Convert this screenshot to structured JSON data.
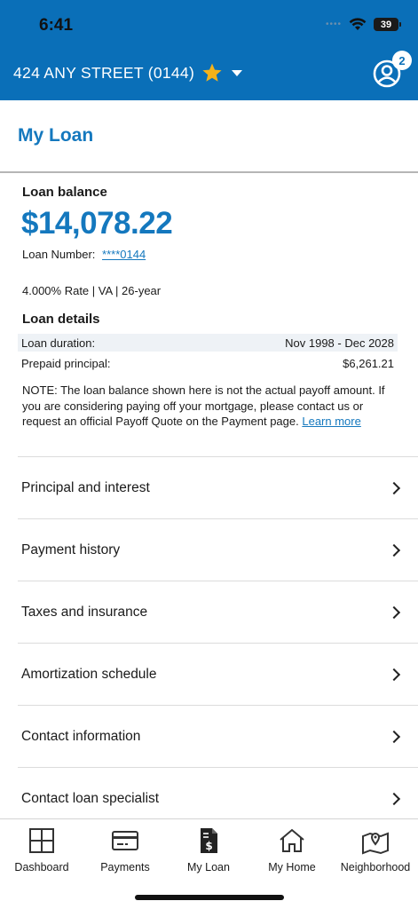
{
  "status_bar": {
    "time": "6:41",
    "battery": "39"
  },
  "header": {
    "address": "424 ANY STREET (0144)",
    "notification_count": "2"
  },
  "page": {
    "title": "My Loan"
  },
  "loan": {
    "balance_label": "Loan balance",
    "balance": "$14,078.22",
    "loan_number_label": "Loan Number:",
    "loan_number": "****0144",
    "rate_line": "4.000% Rate | VA | 26-year"
  },
  "details": {
    "label": "Loan details",
    "rows": [
      {
        "label": "Loan duration:",
        "value": "Nov 1998 - Dec 2028"
      },
      {
        "label": "Prepaid principal:",
        "value": "$6,261.21"
      }
    ],
    "note": "NOTE: The loan balance shown here is not the actual payoff amount. If you are considering paying off your mortgage, please contact us or request an official Payoff Quote on the Payment page.",
    "learn_more": "Learn more"
  },
  "menu": [
    "Principal and interest",
    "Payment history",
    "Taxes and insurance",
    "Amortization schedule",
    "Contact information",
    "Contact loan specialist"
  ],
  "tabs": [
    "Dashboard",
    "Payments",
    "My Loan",
    "My Home",
    "Neighborhood"
  ],
  "colors": {
    "brand": "#0a6fb8",
    "accent": "#1478be",
    "star": "#f5b21a"
  }
}
